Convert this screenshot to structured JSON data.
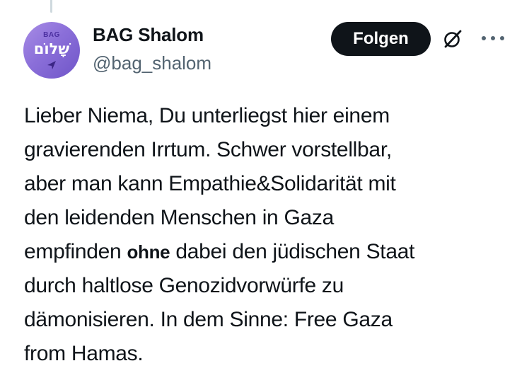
{
  "author": {
    "display_name": "BAG Shalom",
    "handle": "@bag_shalom",
    "avatar": {
      "top_text": "BAG",
      "main_text": "שָׁלוֹם",
      "icon": "paper-plane-icon"
    }
  },
  "actions": {
    "follow_label": "Folgen",
    "grok_icon": "grok-icon",
    "more_icon": "more-dots-icon"
  },
  "tweet": {
    "line1": "Lieber Niema, Du unterliegst hier einem",
    "line2": "gravierenden Irrtum. Schwer vorstellbar,",
    "line3": "aber man kann Empathie&Solidarität mit",
    "line4": "den leidenden Menschen in Gaza",
    "line5_before": "empfinden ",
    "line5_bold": "ohne",
    "line5_after": " dabei den jüdischen Staat",
    "line6": "durch haltlose Genozidvorwürfe zu",
    "line7": "dämonisieren. In dem Sinne: Free Gaza",
    "line8": "from Hamas."
  },
  "colors": {
    "text": "#0f1419",
    "secondary": "#536471",
    "button_bg": "#0f1419",
    "button_text": "#ffffff",
    "avatar_purple": "#8b6fd9",
    "thread_line": "#cfd9de"
  }
}
